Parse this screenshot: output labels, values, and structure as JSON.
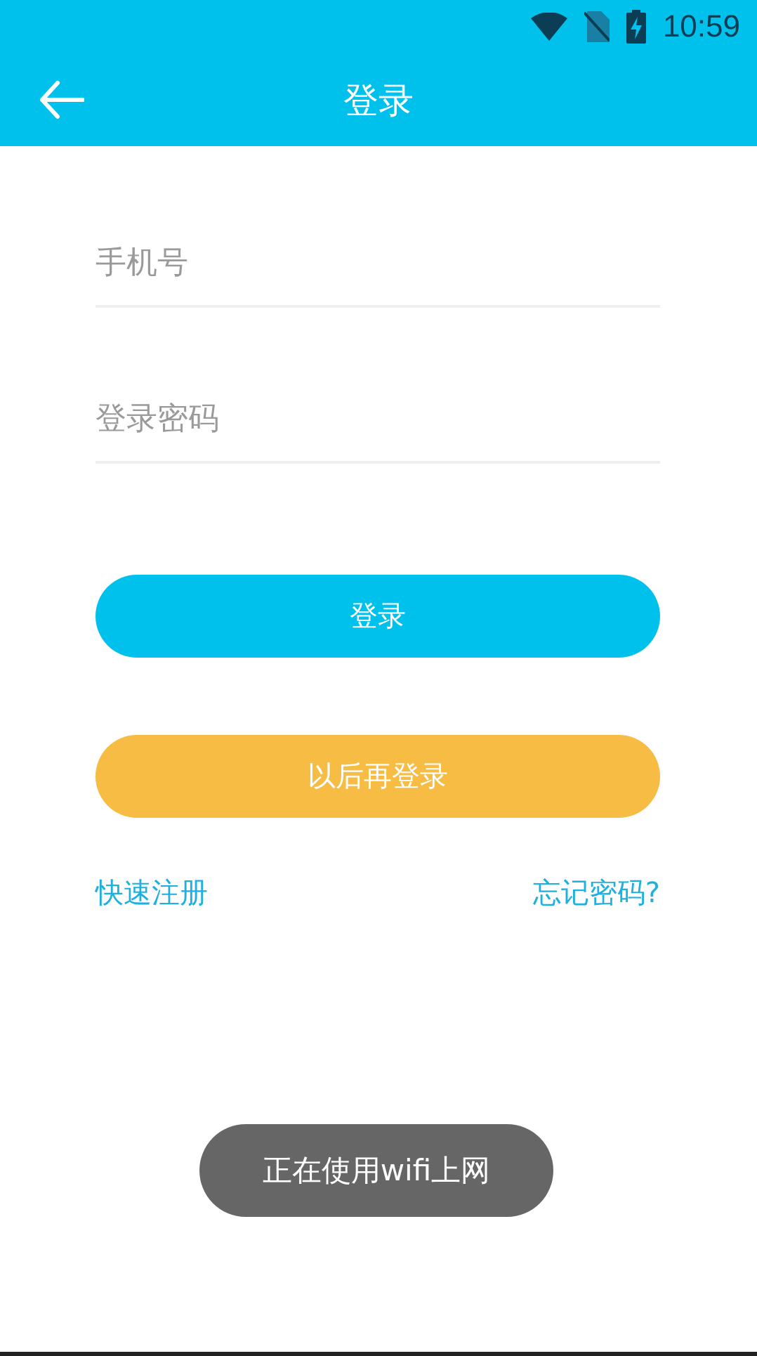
{
  "status_bar": {
    "time": "10:59"
  },
  "app_bar": {
    "title": "登录"
  },
  "fields": [
    {
      "placeholder": "手机号"
    },
    {
      "placeholder": "登录密码"
    }
  ],
  "buttons": [
    {
      "label": "登录",
      "kind": "primary"
    },
    {
      "label": "以后再登录",
      "kind": "secondary"
    }
  ],
  "links": [
    "快速注册",
    "忘记密码?"
  ],
  "toast": "正在使用wifi上网"
}
